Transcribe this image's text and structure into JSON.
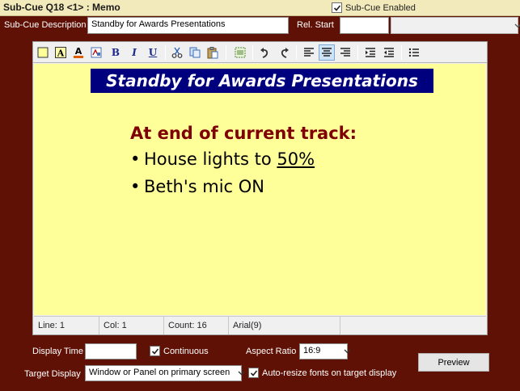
{
  "window": {
    "title": "Sub-Cue Q18 <1> : Memo"
  },
  "sub_cue_enabled": {
    "label": "Sub-Cue Enabled",
    "checked": true
  },
  "description": {
    "label": "Sub-Cue Description",
    "value": "Standby for Awards Presentations"
  },
  "rel_start": {
    "label": "Rel. Start",
    "value": ""
  },
  "toolbar": {
    "buttons": [
      "background-color-icon",
      "highlight-icon",
      "font-color-icon",
      "font-icon",
      "bold-icon",
      "italic-icon",
      "underline-icon",
      "cut-icon",
      "copy-icon",
      "paste-icon",
      "select-all-icon",
      "undo-icon",
      "redo-icon",
      "align-left-icon",
      "align-center-icon",
      "align-right-icon",
      "indent-icon",
      "outdent-icon",
      "bullet-list-icon"
    ],
    "glyphs": {
      "bold": "B",
      "italic": "I",
      "underline": "U"
    },
    "active": "align-center-icon"
  },
  "memo": {
    "banner": "Standby for Awards Presentations",
    "heading": "At end of current track:",
    "bullet_glyph": "•",
    "lines": [
      {
        "text": "House lights to ",
        "emphasis": "50%"
      },
      {
        "text": "Beth's mic ON",
        "emphasis": ""
      }
    ],
    "colors": {
      "background": "#ffff99",
      "banner_bg": "#00007f",
      "heading": "#7f0000"
    }
  },
  "status": {
    "line": "Line: 1",
    "col": "Col: 1",
    "count": "Count: 16",
    "font": "Arial(9)"
  },
  "display_time": {
    "label": "Display Time",
    "value": ""
  },
  "continuous": {
    "label": "Continuous",
    "checked": true
  },
  "aspect_ratio": {
    "label": "Aspect Ratio",
    "value": "16:9"
  },
  "target_display": {
    "label": "Target Display",
    "value": "Window or Panel on primary screen"
  },
  "auto_resize": {
    "label": "Auto-resize fonts on target display",
    "checked": true
  },
  "preview": {
    "label": "Preview"
  },
  "colors": {
    "frame": "#5f1106",
    "titlebar": "#f3eabb",
    "accent": "#00007f"
  }
}
